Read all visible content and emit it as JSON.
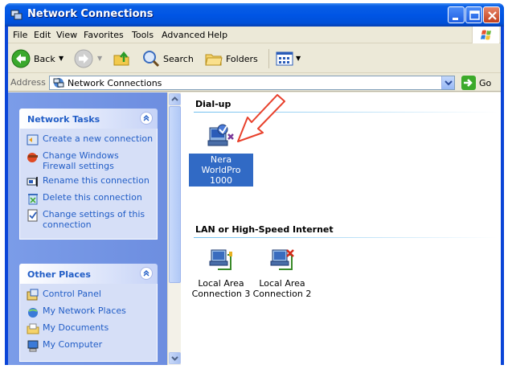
{
  "window": {
    "title": "Network Connections"
  },
  "menu": [
    "File",
    "Edit",
    "View",
    "Favorites",
    "Tools",
    "Advanced",
    "Help"
  ],
  "toolbar": {
    "back_label": "Back",
    "search_label": "Search",
    "folders_label": "Folders"
  },
  "address": {
    "label": "Address",
    "value": "Network Connections",
    "go_label": "Go"
  },
  "network_tasks": {
    "title": "Network Tasks",
    "items": [
      {
        "label": "Create a new connection",
        "icon": "new-connection-icon"
      },
      {
        "label": "Change Windows Firewall settings",
        "icon": "firewall-icon"
      },
      {
        "label": "Rename this connection",
        "icon": "rename-icon"
      },
      {
        "label": "Delete this connection",
        "icon": "delete-icon"
      },
      {
        "label": "Change settings of this connection",
        "icon": "settings-icon"
      }
    ]
  },
  "other_places": {
    "title": "Other Places",
    "items": [
      {
        "label": "Control Panel",
        "icon": "control-panel-icon"
      },
      {
        "label": "My Network Places",
        "icon": "network-places-icon"
      },
      {
        "label": "My Documents",
        "icon": "documents-icon"
      },
      {
        "label": "My Computer",
        "icon": "computer-icon"
      }
    ]
  },
  "groups": {
    "dialup": {
      "title": "Dial-up",
      "items": [
        {
          "label": "Nera WorldPro 1000",
          "selected": true
        }
      ]
    },
    "lan": {
      "title": "LAN or High-Speed Internet",
      "items": [
        {
          "label": "Local Area Connection 3"
        },
        {
          "label": "Local Area Connection 2"
        }
      ]
    }
  },
  "colors": {
    "titlebar": "#0055e5",
    "selection": "#316ac5",
    "task_link": "#215dc6",
    "annotation_arrow": "#e8412c"
  }
}
